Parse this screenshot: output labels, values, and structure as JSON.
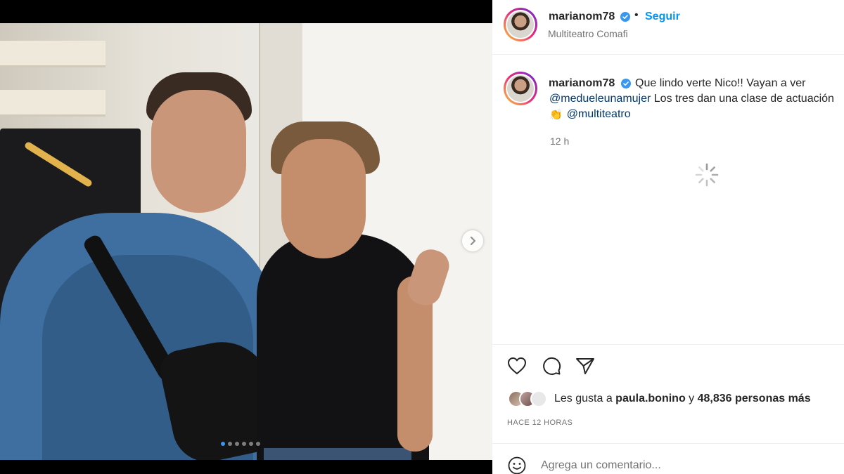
{
  "post": {
    "username": "marianom78",
    "separator": "•",
    "follow_label": "Seguir",
    "location": "Multiteatro Comafi"
  },
  "caption": {
    "username": "marianom78",
    "text_line1": "Que lindo verte Nico!! Vayan a ver",
    "mention1": "@medueleunamujer",
    "text_line2": " Los tres dan una clase de actuación",
    "clap_emoji": "👏",
    "mention2": "@multiteatro",
    "time": "12 h"
  },
  "likes": {
    "prefix": "Les gusta a ",
    "user": "paula.bonino",
    "middle": " y ",
    "count": "48,836 personas más"
  },
  "time_caps": "HACE 12 HORAS",
  "comment": {
    "placeholder": "Agrega un comentario..."
  },
  "carousel": {
    "slide_count": 6,
    "active_index": 0
  },
  "colors": {
    "accent": "#0095f6",
    "verified": "#3897f0",
    "mention": "#00376b",
    "active_dot": "#3a95ef"
  },
  "icons": {
    "like": "heart-icon",
    "comment": "comment-icon",
    "share": "paper-plane-icon",
    "emoji": "smiley-icon",
    "next": "chevron-right-icon",
    "verified": "verified-badge-icon",
    "loading": "spinner-icon"
  }
}
